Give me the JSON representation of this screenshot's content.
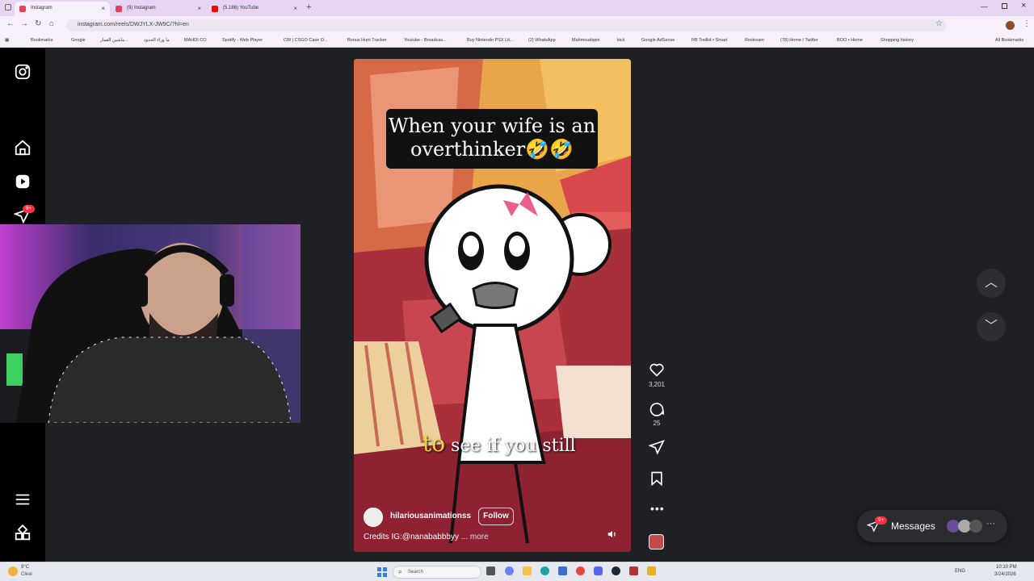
{
  "browser": {
    "tabs": [
      {
        "label": "Instagram",
        "color": "#e4405f"
      },
      {
        "label": "(9) Instagram",
        "color": "#e4405f"
      },
      {
        "label": "(5,186) YouTube",
        "color": "#ff0000"
      }
    ],
    "url": "instagram.com/reels/DWJYLX-JW9C/?hl=en",
    "bookmarks": [
      "Bookmarks",
      "Google",
      "ماشين القمار...",
      "ما وراء الحدود",
      "MAHDI CO",
      "Spotify - Web Player",
      "CW | CSGO Case O...",
      "Bonus Hunt Tracker",
      "Youtube - Broadcas...",
      "Buy Nintendo PSX Lit...",
      "(2) WhatsApp",
      "Mahmoudspin",
      "kick",
      "Google AdSense",
      "RB Toolkit • Smart",
      "Restream",
      "(78) Home / Twitter",
      "BOO • Home",
      "Shopping history",
      "All Bookmarks"
    ]
  },
  "sidebar": {
    "notifications_badge": "9+"
  },
  "reel": {
    "caption_title": "When your wife is an overthinker🤣🤣",
    "subtitle_highlight": "to",
    "subtitle_rest": " see if you still",
    "username": "hilariousanimationss",
    "follow_label": "Follow",
    "credits": "Credits IG:@nanababbbyy",
    "more_label": "... more"
  },
  "actions": {
    "likes": "3,201",
    "comments": "25"
  },
  "messages": {
    "label": "Messages",
    "badge": "9+"
  },
  "taskbar": {
    "weather_temp": "9°C",
    "weather_desc": "Clear",
    "search_placeholder": "Search",
    "lang": "ENG",
    "time": "10:10 PM",
    "date": "3/24/2026"
  },
  "colors": {
    "accent": "#0095f6",
    "badge": "#ff3040",
    "tab_bar": "#e8d4f3"
  }
}
